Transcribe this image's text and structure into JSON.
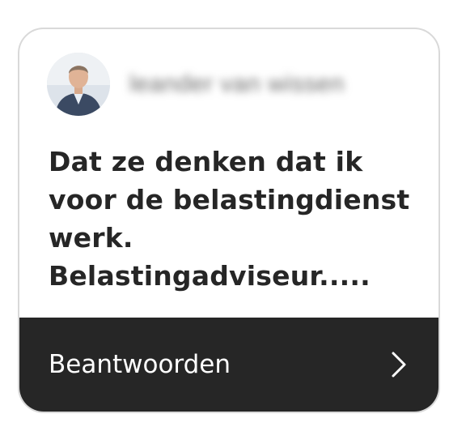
{
  "card": {
    "username": "leander van wissen",
    "message": "Dat ze denken dat ik voor de belastingdienst werk. Belastingadviseur.....",
    "reply_label": "Beantwoorden",
    "icons": {
      "avatar": "profile-photo",
      "reply": "chevron-right-icon"
    }
  },
  "colors": {
    "card_border": "#d9d9d9",
    "footer_bg": "#262626",
    "text_dark": "#262626",
    "text_light": "#ffffff"
  }
}
